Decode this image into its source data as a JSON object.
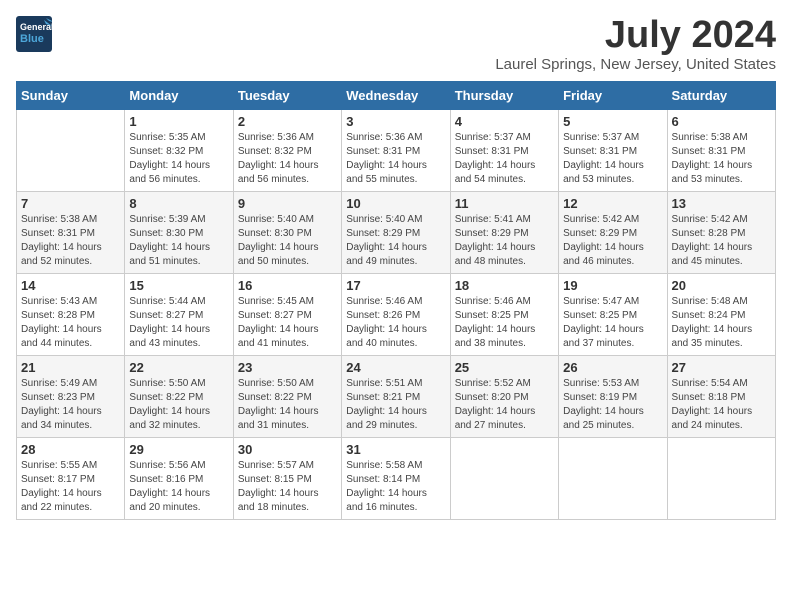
{
  "logo": {
    "line1": "General",
    "line2": "Blue"
  },
  "title": "July 2024",
  "location": "Laurel Springs, New Jersey, United States",
  "weekdays": [
    "Sunday",
    "Monday",
    "Tuesday",
    "Wednesday",
    "Thursday",
    "Friday",
    "Saturday"
  ],
  "weeks": [
    [
      {
        "day": "",
        "sunrise": "",
        "sunset": "",
        "daylight": ""
      },
      {
        "day": "1",
        "sunrise": "Sunrise: 5:35 AM",
        "sunset": "Sunset: 8:32 PM",
        "daylight": "Daylight: 14 hours and 56 minutes."
      },
      {
        "day": "2",
        "sunrise": "Sunrise: 5:36 AM",
        "sunset": "Sunset: 8:32 PM",
        "daylight": "Daylight: 14 hours and 56 minutes."
      },
      {
        "day": "3",
        "sunrise": "Sunrise: 5:36 AM",
        "sunset": "Sunset: 8:31 PM",
        "daylight": "Daylight: 14 hours and 55 minutes."
      },
      {
        "day": "4",
        "sunrise": "Sunrise: 5:37 AM",
        "sunset": "Sunset: 8:31 PM",
        "daylight": "Daylight: 14 hours and 54 minutes."
      },
      {
        "day": "5",
        "sunrise": "Sunrise: 5:37 AM",
        "sunset": "Sunset: 8:31 PM",
        "daylight": "Daylight: 14 hours and 53 minutes."
      },
      {
        "day": "6",
        "sunrise": "Sunrise: 5:38 AM",
        "sunset": "Sunset: 8:31 PM",
        "daylight": "Daylight: 14 hours and 53 minutes."
      }
    ],
    [
      {
        "day": "7",
        "sunrise": "Sunrise: 5:38 AM",
        "sunset": "Sunset: 8:31 PM",
        "daylight": "Daylight: 14 hours and 52 minutes."
      },
      {
        "day": "8",
        "sunrise": "Sunrise: 5:39 AM",
        "sunset": "Sunset: 8:30 PM",
        "daylight": "Daylight: 14 hours and 51 minutes."
      },
      {
        "day": "9",
        "sunrise": "Sunrise: 5:40 AM",
        "sunset": "Sunset: 8:30 PM",
        "daylight": "Daylight: 14 hours and 50 minutes."
      },
      {
        "day": "10",
        "sunrise": "Sunrise: 5:40 AM",
        "sunset": "Sunset: 8:29 PM",
        "daylight": "Daylight: 14 hours and 49 minutes."
      },
      {
        "day": "11",
        "sunrise": "Sunrise: 5:41 AM",
        "sunset": "Sunset: 8:29 PM",
        "daylight": "Daylight: 14 hours and 48 minutes."
      },
      {
        "day": "12",
        "sunrise": "Sunrise: 5:42 AM",
        "sunset": "Sunset: 8:29 PM",
        "daylight": "Daylight: 14 hours and 46 minutes."
      },
      {
        "day": "13",
        "sunrise": "Sunrise: 5:42 AM",
        "sunset": "Sunset: 8:28 PM",
        "daylight": "Daylight: 14 hours and 45 minutes."
      }
    ],
    [
      {
        "day": "14",
        "sunrise": "Sunrise: 5:43 AM",
        "sunset": "Sunset: 8:28 PM",
        "daylight": "Daylight: 14 hours and 44 minutes."
      },
      {
        "day": "15",
        "sunrise": "Sunrise: 5:44 AM",
        "sunset": "Sunset: 8:27 PM",
        "daylight": "Daylight: 14 hours and 43 minutes."
      },
      {
        "day": "16",
        "sunrise": "Sunrise: 5:45 AM",
        "sunset": "Sunset: 8:27 PM",
        "daylight": "Daylight: 14 hours and 41 minutes."
      },
      {
        "day": "17",
        "sunrise": "Sunrise: 5:46 AM",
        "sunset": "Sunset: 8:26 PM",
        "daylight": "Daylight: 14 hours and 40 minutes."
      },
      {
        "day": "18",
        "sunrise": "Sunrise: 5:46 AM",
        "sunset": "Sunset: 8:25 PM",
        "daylight": "Daylight: 14 hours and 38 minutes."
      },
      {
        "day": "19",
        "sunrise": "Sunrise: 5:47 AM",
        "sunset": "Sunset: 8:25 PM",
        "daylight": "Daylight: 14 hours and 37 minutes."
      },
      {
        "day": "20",
        "sunrise": "Sunrise: 5:48 AM",
        "sunset": "Sunset: 8:24 PM",
        "daylight": "Daylight: 14 hours and 35 minutes."
      }
    ],
    [
      {
        "day": "21",
        "sunrise": "Sunrise: 5:49 AM",
        "sunset": "Sunset: 8:23 PM",
        "daylight": "Daylight: 14 hours and 34 minutes."
      },
      {
        "day": "22",
        "sunrise": "Sunrise: 5:50 AM",
        "sunset": "Sunset: 8:22 PM",
        "daylight": "Daylight: 14 hours and 32 minutes."
      },
      {
        "day": "23",
        "sunrise": "Sunrise: 5:50 AM",
        "sunset": "Sunset: 8:22 PM",
        "daylight": "Daylight: 14 hours and 31 minutes."
      },
      {
        "day": "24",
        "sunrise": "Sunrise: 5:51 AM",
        "sunset": "Sunset: 8:21 PM",
        "daylight": "Daylight: 14 hours and 29 minutes."
      },
      {
        "day": "25",
        "sunrise": "Sunrise: 5:52 AM",
        "sunset": "Sunset: 8:20 PM",
        "daylight": "Daylight: 14 hours and 27 minutes."
      },
      {
        "day": "26",
        "sunrise": "Sunrise: 5:53 AM",
        "sunset": "Sunset: 8:19 PM",
        "daylight": "Daylight: 14 hours and 25 minutes."
      },
      {
        "day": "27",
        "sunrise": "Sunrise: 5:54 AM",
        "sunset": "Sunset: 8:18 PM",
        "daylight": "Daylight: 14 hours and 24 minutes."
      }
    ],
    [
      {
        "day": "28",
        "sunrise": "Sunrise: 5:55 AM",
        "sunset": "Sunset: 8:17 PM",
        "daylight": "Daylight: 14 hours and 22 minutes."
      },
      {
        "day": "29",
        "sunrise": "Sunrise: 5:56 AM",
        "sunset": "Sunset: 8:16 PM",
        "daylight": "Daylight: 14 hours and 20 minutes."
      },
      {
        "day": "30",
        "sunrise": "Sunrise: 5:57 AM",
        "sunset": "Sunset: 8:15 PM",
        "daylight": "Daylight: 14 hours and 18 minutes."
      },
      {
        "day": "31",
        "sunrise": "Sunrise: 5:58 AM",
        "sunset": "Sunset: 8:14 PM",
        "daylight": "Daylight: 14 hours and 16 minutes."
      },
      {
        "day": "",
        "sunrise": "",
        "sunset": "",
        "daylight": ""
      },
      {
        "day": "",
        "sunrise": "",
        "sunset": "",
        "daylight": ""
      },
      {
        "day": "",
        "sunrise": "",
        "sunset": "",
        "daylight": ""
      }
    ]
  ]
}
